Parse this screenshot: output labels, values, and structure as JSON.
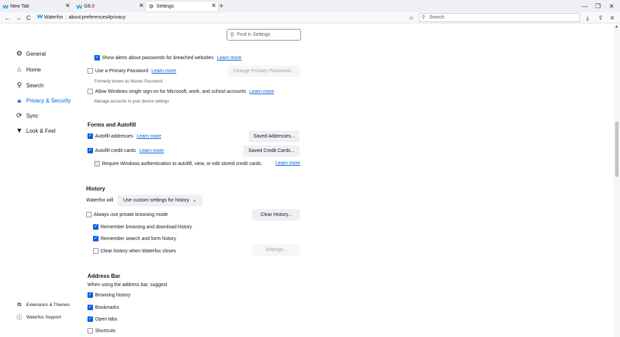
{
  "tabs": [
    {
      "label": "New Tab",
      "active": false
    },
    {
      "label": "G6.0",
      "active": false
    },
    {
      "label": "Settings",
      "active": true
    }
  ],
  "toolbar": {
    "browser_name": "Waterfox",
    "url": "about:preferences#privacy",
    "search_placeholder": "Search"
  },
  "find_placeholder": "Find in Settings",
  "sidebar": {
    "items": [
      {
        "label": "General",
        "icon": "gear-icon"
      },
      {
        "label": "Home",
        "icon": "home-icon"
      },
      {
        "label": "Search",
        "icon": "search-icon"
      },
      {
        "label": "Privacy & Security",
        "icon": "lock-icon",
        "selected": true
      },
      {
        "label": "Sync",
        "icon": "sync-icon"
      },
      {
        "label": "Look & Feel",
        "icon": "brush-icon"
      }
    ],
    "footer": [
      {
        "label": "Extensions & Themes",
        "icon": "puzzle-icon"
      },
      {
        "label": "Waterfox Support",
        "icon": "help-icon"
      }
    ]
  },
  "passwords": {
    "breach_alerts": "Show alerts about passwords for breached websites",
    "breach_link": "Learn more",
    "primary_password": "Use a Primary Password",
    "primary_link": "Learn more",
    "change_primary_btn": "Change Primary Password...",
    "formerly": "Formerly known as Master Password",
    "windows_sso": "Allow Windows single sign-on for Microsoft, work, and school accounts",
    "windows_sso_link": "Learn more",
    "manage_accounts": "Manage accounts in your device settings"
  },
  "forms": {
    "heading": "Forms and Autofill",
    "autofill_addresses": "Autofill addresses",
    "autofill_addresses_link": "Learn more",
    "saved_addresses_btn": "Saved Addresses...",
    "autofill_cards": "Autofill credit cards",
    "autofill_cards_link": "Learn more",
    "saved_cards_btn": "Saved Credit Cards...",
    "require_auth": "Require Windows authentication to autofill, view, or edit stored credit cards.",
    "require_auth_link": "Learn more"
  },
  "history": {
    "heading": "History",
    "will_label": "Waterfox will",
    "mode_select": "Use custom settings for history",
    "private_mode": "Always use private browsing mode",
    "clear_history_btn": "Clear History...",
    "remember_browsing": "Remember browsing and download history",
    "remember_search": "Remember search and form history",
    "clear_on_close": "Clear history when Waterfox closes",
    "settings_btn": "Settings..."
  },
  "address_bar": {
    "heading": "Address Bar",
    "suggest_label": "When using the address bar, suggest",
    "browsing_history": "Browsing history",
    "bookmarks": "Bookmarks",
    "open_tabs": "Open tabs",
    "shortcuts": "Shortcuts"
  },
  "colors": {
    "accent": "#0061e0",
    "waterfox_brand": "#1a9fe0"
  }
}
